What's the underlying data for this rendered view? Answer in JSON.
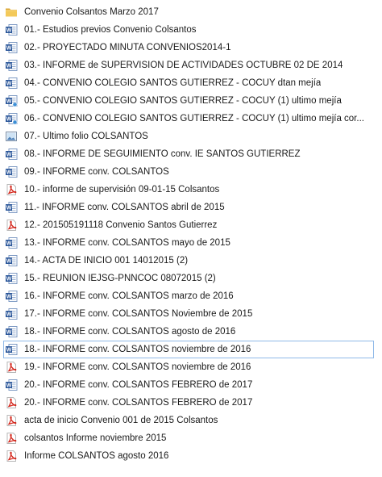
{
  "files": [
    {
      "name": "Convenio Colsantos Marzo 2017",
      "icon": "folder-icon"
    },
    {
      "name": "01.- Estudios previos Convenio Colsantos",
      "icon": "word-doc-icon"
    },
    {
      "name": "02.- PROYECTADO MINUTA CONVENIOS2014-1",
      "icon": "word-doc-icon"
    },
    {
      "name": "03.- INFORME de SUPERVISION DE ACTIVIDADES OCTUBRE 02 DE 2014",
      "icon": "word-doc-icon"
    },
    {
      "name": "04.- CONVENIO COLEGIO SANTOS GUTIERREZ - COCUY dtan mejía",
      "icon": "word-doc-icon"
    },
    {
      "name": "05.- CONVENIO COLEGIO SANTOS GUTIERREZ - COCUY (1) ultimo mejía",
      "icon": "word-doc-icon-alt"
    },
    {
      "name": "06.- CONVENIO COLEGIO SANTOS GUTIERREZ - COCUY (1) ultimo mejía cor...",
      "icon": "word-doc-icon-alt"
    },
    {
      "name": "07.- Ultimo folio COLSANTOS",
      "icon": "image-file-icon"
    },
    {
      "name": "08.- INFORME DE SEGUIMIENTO conv. IE SANTOS GUTIERREZ",
      "icon": "word-doc-icon"
    },
    {
      "name": "09.- INFORME conv. COLSANTOS",
      "icon": "word-doc-icon"
    },
    {
      "name": "10.- informe de supervisión 09-01-15 Colsantos",
      "icon": "pdf-icon"
    },
    {
      "name": "11.- INFORME conv. COLSANTOS abril de 2015",
      "icon": "word-doc-icon"
    },
    {
      "name": "12.- 201505191118 Convenio Santos Gutierrez",
      "icon": "pdf-icon"
    },
    {
      "name": "13.- INFORME conv. COLSANTOS mayo de 2015",
      "icon": "word-doc-icon"
    },
    {
      "name": "14.- ACTA DE INICIO 001 14012015 (2)",
      "icon": "word-doc-icon"
    },
    {
      "name": "15.- REUNION IEJSG-PNNCOC 08072015 (2)",
      "icon": "word-doc-icon"
    },
    {
      "name": "16.- INFORME conv. COLSANTOS marzo de 2016",
      "icon": "word-doc-icon"
    },
    {
      "name": "17.- INFORME conv. COLSANTOS Noviembre de 2015",
      "icon": "word-doc-icon"
    },
    {
      "name": "18.- INFORME conv. COLSANTOS agosto de 2016",
      "icon": "word-doc-icon"
    },
    {
      "name": "18.- INFORME conv. COLSANTOS noviembre de 2016",
      "icon": "word-doc-icon",
      "selected": true
    },
    {
      "name": "19.- INFORME conv. COLSANTOS noviembre de 2016",
      "icon": "pdf-icon"
    },
    {
      "name": "20.- INFORME conv. COLSANTOS FEBRERO de 2017",
      "icon": "word-doc-icon"
    },
    {
      "name": "20.- INFORME conv. COLSANTOS FEBRERO de 2017",
      "icon": "pdf-icon"
    },
    {
      "name": "acta de inicio Convenio 001 de 2015 Colsantos",
      "icon": "pdf-icon"
    },
    {
      "name": "colsantos Informe noviembre 2015",
      "icon": "pdf-icon"
    },
    {
      "name": "Informe COLSANTOS agosto 2016",
      "icon": "pdf-icon"
    }
  ],
  "colors": {
    "selection_border": "#8fb9e8",
    "word_blue": "#2b579a",
    "pdf_red": "#d42a1f",
    "folder_yellow": "#e8b840"
  }
}
